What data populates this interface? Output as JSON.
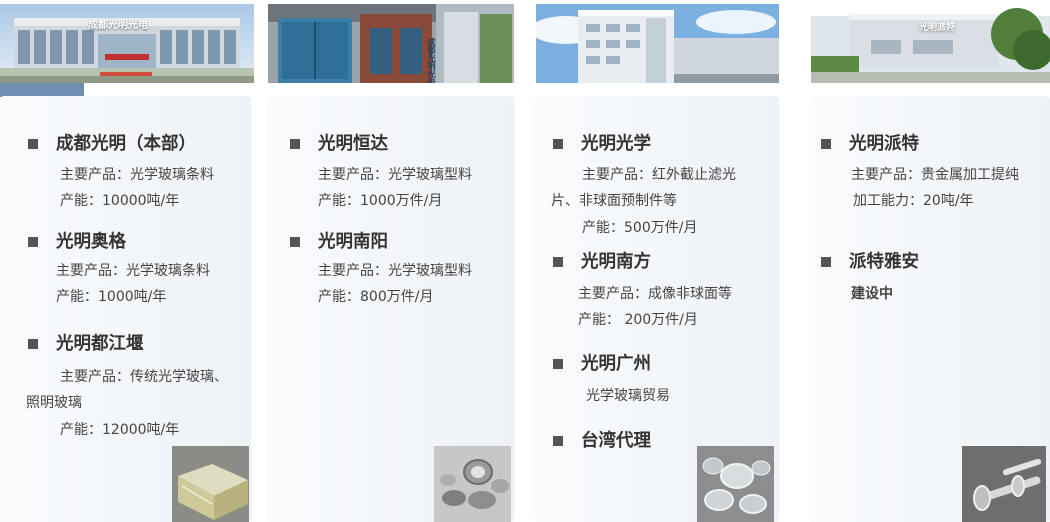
{
  "photos": {
    "p1_sign": "成都光明光电",
    "p2_sign": "成都光明光电",
    "p4_sign": "光明派特"
  },
  "card1": {
    "s1": {
      "title": "成都光明（本部）",
      "l1": "主要产品：光学玻璃条料",
      "l2": "产能：10000吨/年"
    },
    "s2": {
      "title": "光明奥格",
      "l1": "主要产品：光学玻璃条料",
      "l2": "产能：1000吨/年"
    },
    "s3": {
      "title": "光明都江堰",
      "l1": "主要产品：传统光学玻璃、",
      "l1b": "照明玻璃",
      "l2": "产能：12000吨/年"
    }
  },
  "card2": {
    "s1": {
      "title": "光明恒达",
      "l1": "主要产品：光学玻璃型料",
      "l2": "产能：1000万件/月"
    },
    "s2": {
      "title": "光明南阳",
      "l1": "主要产品：光学玻璃型料",
      "l2": "产能：800万件/月"
    }
  },
  "card3": {
    "s1": {
      "title": "光明光学",
      "l1": "主要产品：红外截止滤光",
      "l1b": "片、非球面预制件等",
      "l2": "产能：500万件/月"
    },
    "s2": {
      "title": "光明南方",
      "l1": "主要产品：成像非球面等",
      "l2": "产能： 200万件/月"
    },
    "s3": {
      "title": "光明广州",
      "l1": "光学玻璃贸易"
    },
    "s4": {
      "title": "台湾代理"
    }
  },
  "card4": {
    "s1": {
      "title": "光明派特",
      "l1": "主要产品：贵金属加工提纯",
      "l2": "加工能力：20吨/年"
    },
    "s2": {
      "title": "派特雅安",
      "l1": "建设中"
    }
  }
}
